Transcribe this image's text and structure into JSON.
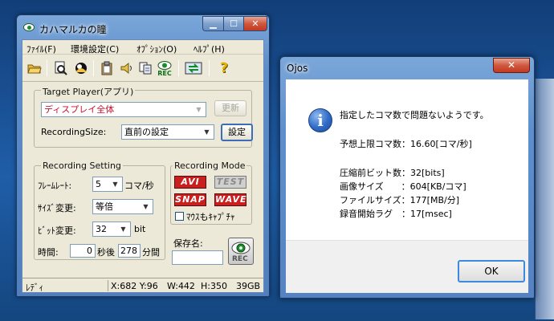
{
  "main_window": {
    "title": "カハマルカの瞳",
    "caption": {
      "min": "▁",
      "max": "☐",
      "close": "✕"
    },
    "menu": [
      "ﾌｧｲﾙ(F)",
      "環境設定(C)",
      "ｵﾌﾟｼｮﾝ(O)",
      "ﾍﾙﾌﾟ(H)"
    ],
    "toolbar": {
      "icons": [
        "open-folder-icon",
        "preview-icon",
        "snapshot-icon",
        "clipboard-icon",
        "speaker-icon",
        "copy-icon",
        "rec-icon",
        "switch-icon",
        "help-icon"
      ],
      "rec_label": "REC"
    },
    "target": {
      "group_label": "Target Player(アプリ)",
      "player_value": "ディスプレイ全体",
      "refresh_label": "更新",
      "size_label": "RecordingSize:",
      "size_value": "直前の設定",
      "set_label": "設定"
    },
    "rec_setting": {
      "group_label": "Recording Setting",
      "frame_rate_label": "ﾌﾚｰﾑﾚｰﾄ:",
      "frame_rate_value": "5",
      "frame_rate_unit": "コマ/秒",
      "size_change_label": "ｻｲｽﾞ変更:",
      "size_change_value": "等倍",
      "bit_change_label": "ﾋﾞｯﾄ変更:",
      "bit_value": "32",
      "bit_unit": "bit",
      "time_label": "時間:",
      "time_seconds": "0",
      "time_seconds_unit": "秒後",
      "time_minutes": "278",
      "time_minutes_unit": "分間"
    },
    "rec_mode": {
      "group_label": "Recording Mode",
      "avi": "AVI",
      "test": "TEST",
      "snap": "SNAP",
      "wave": "WAVE",
      "capture_cursor_label": "ﾏｳｽもｷｬﾌﾟﾁｬ",
      "save_name_label": "保存名:",
      "rec_label": "REC"
    },
    "status": {
      "state": "ﾚﾃﾞｨ",
      "coords": "X:682 Y:96",
      "width": "W:442",
      "height": "H:350",
      "disk": "39GB"
    }
  },
  "dialog": {
    "title": "Ojos",
    "close": "✕",
    "icon": "i",
    "message": "指定したコマ数で問題ないようです。",
    "max_fps": "予想上限コマ数：16.60[コマ/秒]",
    "bits": "圧縮前ビット数：32[bits]",
    "image_size": "画像サイズ　　：604[KB/コマ]",
    "file_size": "ファイルサイズ：177[MB/分]",
    "audio_lag": "録音開始ラグ　：17[msec]",
    "ok_label": "OK"
  }
}
